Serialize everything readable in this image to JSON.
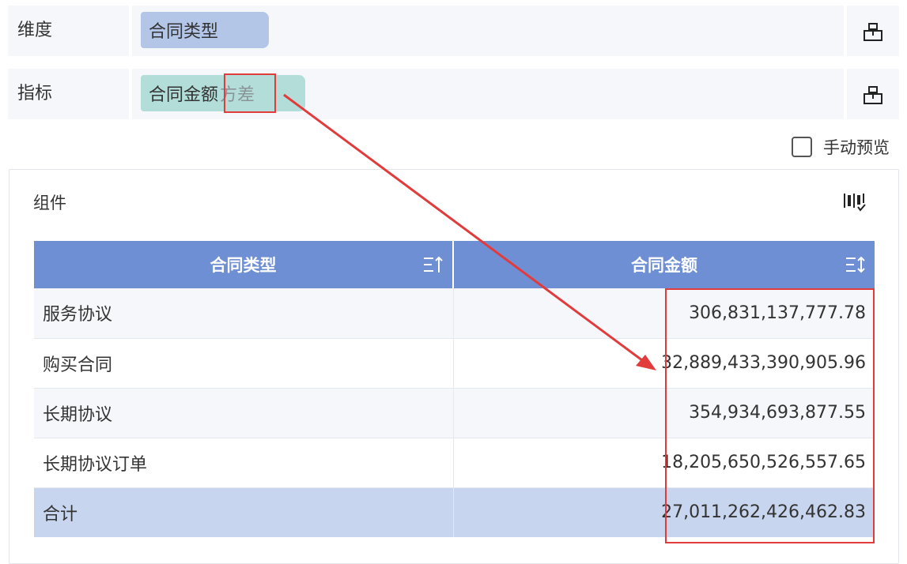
{
  "dimension": {
    "label": "维度",
    "field": "合同类型"
  },
  "metric": {
    "label": "指标",
    "field": "合同金额",
    "aggregation": "方差"
  },
  "icons": {
    "hierarchy": "hierarchy-icon",
    "chart_type": "chart-type-icon",
    "sort_asc": "sort-ascending-icon",
    "sort_both": "sort-icon"
  },
  "manual_preview": {
    "label": "手动预览",
    "checked": false
  },
  "component": {
    "title": "组件"
  },
  "table": {
    "headers": [
      "合同类型",
      "合同金额"
    ],
    "rows": [
      {
        "type": "服务协议",
        "amount": "306,831,137,777.78"
      },
      {
        "type": "购买合同",
        "amount": "32,889,433,390,905.96"
      },
      {
        "type": "长期协议",
        "amount": "354,934,693,877.55"
      },
      {
        "type": "长期协议订单",
        "amount": "18,205,650,526,557.65"
      }
    ],
    "total": {
      "label": "合计",
      "amount": "27,011,262,426,462.83"
    }
  },
  "colors": {
    "header_bg": "#6f8fd4",
    "dimension_pill": "#b3c6e7",
    "metric_pill": "#b2ddd8",
    "total_row": "#c8d5ef",
    "annotation": "#e23b3b"
  }
}
